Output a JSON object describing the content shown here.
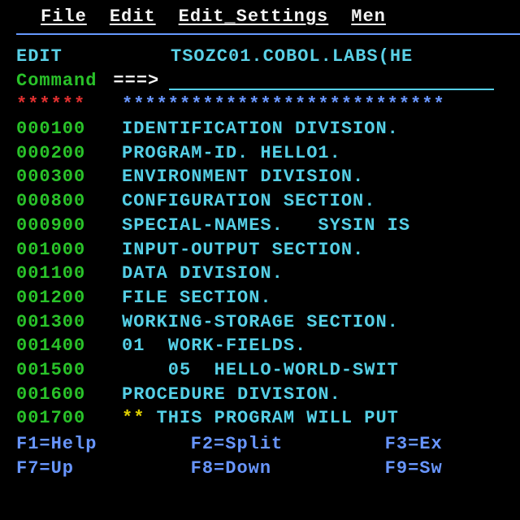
{
  "menubar": {
    "file": "File",
    "edit": "Edit",
    "edit_settings": "Edit_Settings",
    "menu": "Men"
  },
  "header": {
    "mode": "EDIT",
    "dataset": "TSOZC01.COBOL.LABS(HE"
  },
  "command": {
    "label": "Command",
    "arrow": "===>"
  },
  "top": {
    "stars_left": "******",
    "stars_right": "****************************"
  },
  "lines": [
    {
      "num": "000100",
      "text": "IDENTIFICATION DIVISION."
    },
    {
      "num": "000200",
      "text": "PROGRAM-ID. HELLO1."
    },
    {
      "num": "000300",
      "text": "ENVIRONMENT DIVISION."
    },
    {
      "num": "000800",
      "text": "CONFIGURATION SECTION."
    },
    {
      "num": "000900",
      "text": "SPECIAL-NAMES.   SYSIN IS"
    },
    {
      "num": "001000",
      "text": "INPUT-OUTPUT SECTION."
    },
    {
      "num": "001100",
      "text": "DATA DIVISION."
    },
    {
      "num": "001200",
      "text": "FILE SECTION."
    },
    {
      "num": "001300",
      "text": "WORKING-STORAGE SECTION."
    },
    {
      "num": "001400",
      "text": "01  WORK-FIELDS."
    },
    {
      "num": "001500",
      "text": "    05  HELLO-WORLD-SWIT"
    },
    {
      "num": "001600",
      "text": "PROCEDURE DIVISION."
    }
  ],
  "comment": {
    "num": "001700",
    "stars": "**",
    "text": " THIS PROGRAM WILL PUT "
  },
  "fkeys": {
    "f1": "F1=Help",
    "f2": "F2=Split",
    "f3": "F3=Ex",
    "f7": "F7=Up",
    "f8": "F8=Down",
    "f9": "F9=Sw"
  }
}
